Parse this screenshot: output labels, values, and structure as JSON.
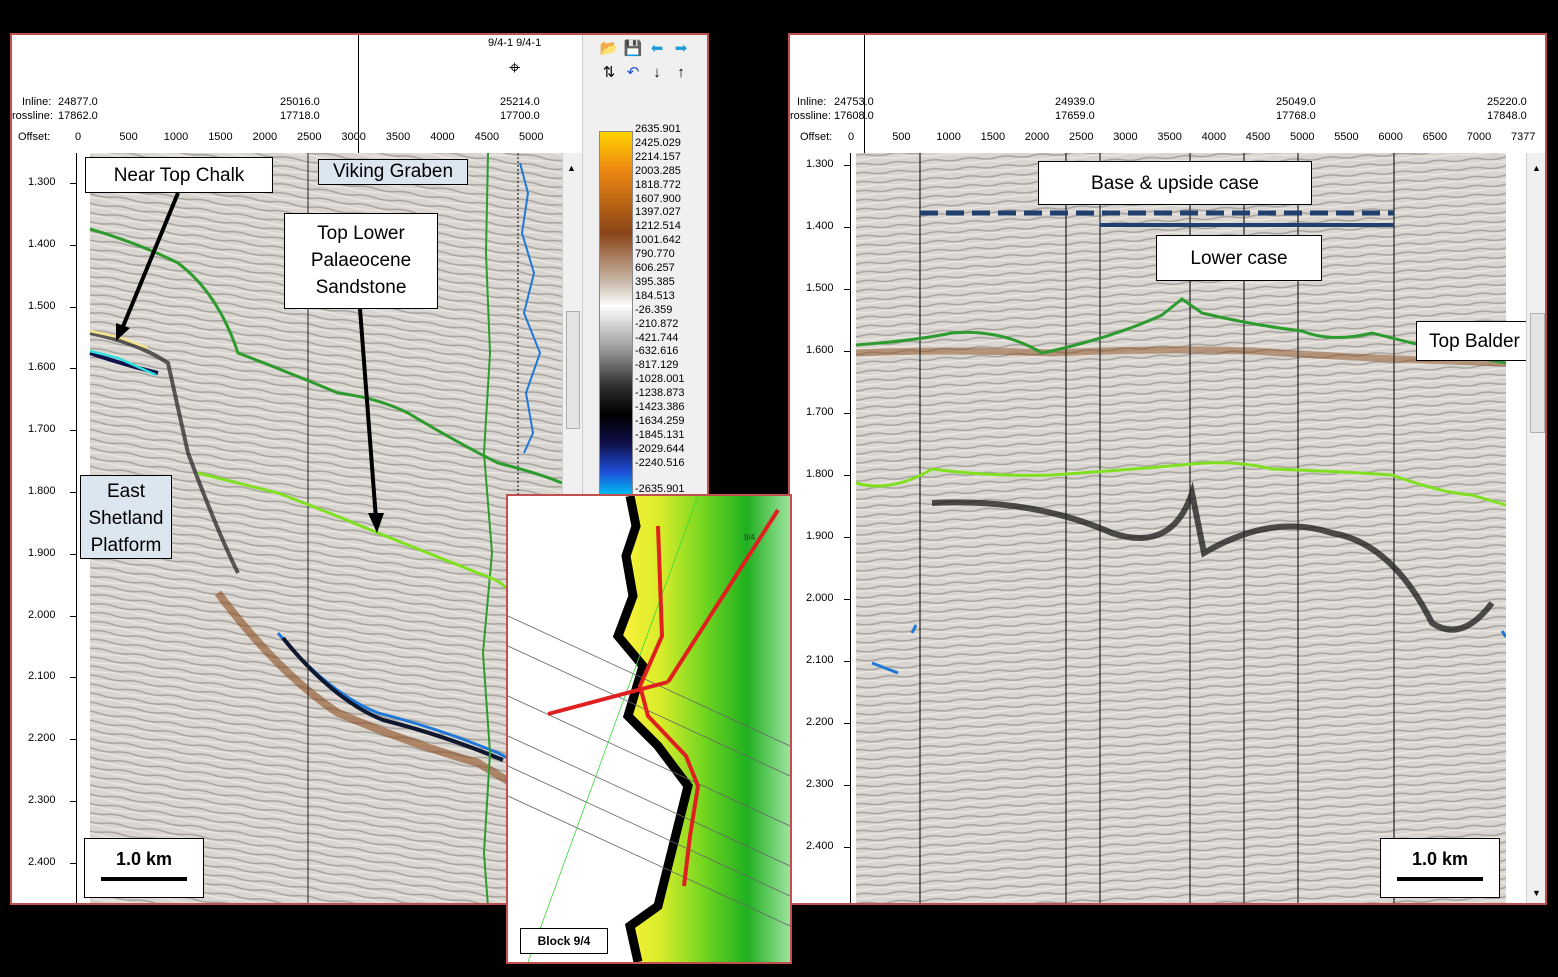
{
  "left_view": {
    "header": {
      "well_label": "9/4-1 9/4-1",
      "inline_label": "Inline:",
      "crossline_label": "rossline:",
      "offset_label": "Offset:",
      "inline_values": [
        "24877.0",
        "25016.0",
        "25214.0"
      ],
      "crossline_values": [
        "17862.0",
        "17718.0",
        "17700.0"
      ],
      "offsets": [
        "0",
        "500",
        "1000",
        "1500",
        "2000",
        "2500",
        "3000",
        "3500",
        "4000",
        "4500",
        "5000"
      ]
    },
    "time_ticks": [
      "1.300",
      "1.400",
      "1.500",
      "1.600",
      "1.700",
      "1.800",
      "1.900",
      "2.000",
      "2.100",
      "2.200",
      "2.300",
      "2.400"
    ],
    "annotations": {
      "near_top_chalk": "Near Top Chalk",
      "viking_graben": "Viking Graben",
      "top_lower_palaeocene": [
        "Top Lower",
        "Palaeocene",
        "Sandstone"
      ],
      "east_shetland": [
        "East",
        "Shetland",
        "Platform"
      ]
    },
    "scale_label": "1.0 km",
    "colorbar_values": [
      "2635.901",
      "2425.029",
      "2214.157",
      "2003.285",
      "1818.772",
      "1607.900",
      "1397.027",
      "1212.514",
      "1001.642",
      "790.770",
      "606.257",
      "395.385",
      "184.513",
      "-26.359",
      "-210.872",
      "-421.744",
      "-632.616",
      "-817.129",
      "-1028.001",
      "-1238.873",
      "-1423.386",
      "-1634.259",
      "-1845.131",
      "-2029.644",
      "-2240.516",
      "-2635.901"
    ]
  },
  "right_view": {
    "header": {
      "inline_label": "Inline:",
      "crossline_label": "rossline:",
      "offset_label": "Offset:",
      "inline_values": [
        "24753.0",
        "24939.0",
        "25049.0",
        "25220.0"
      ],
      "crossline_values": [
        "17608.0",
        "17659.0",
        "17768.0",
        "17848.0"
      ],
      "offsets": [
        "0",
        "500",
        "1000",
        "1500",
        "2000",
        "2500",
        "3000",
        "3500",
        "4000",
        "4500",
        "5000",
        "5500",
        "6000",
        "6500",
        "7000",
        "7377"
      ]
    },
    "time_ticks": [
      "1.300",
      "1.400",
      "1.500",
      "1.600",
      "1.700",
      "1.800",
      "1.900",
      "2.000",
      "2.100",
      "2.200",
      "2.300",
      "2.400"
    ],
    "annotations": {
      "base_upside": "Base & upside case",
      "lower_case": "Lower case",
      "top_balder": "Top Balder"
    },
    "scale_label": "1.0 km"
  },
  "inset_map": {
    "label": "Block 9/4",
    "well_tag": "9/4"
  },
  "colors": {
    "panel_border": "#c0504d",
    "horizon_green": "#2e9b2e",
    "horizon_lime": "#7fe020",
    "horizon_blue": "#1e78d8",
    "case_bar": "#1f3f6e",
    "section_red": "#e02020"
  }
}
